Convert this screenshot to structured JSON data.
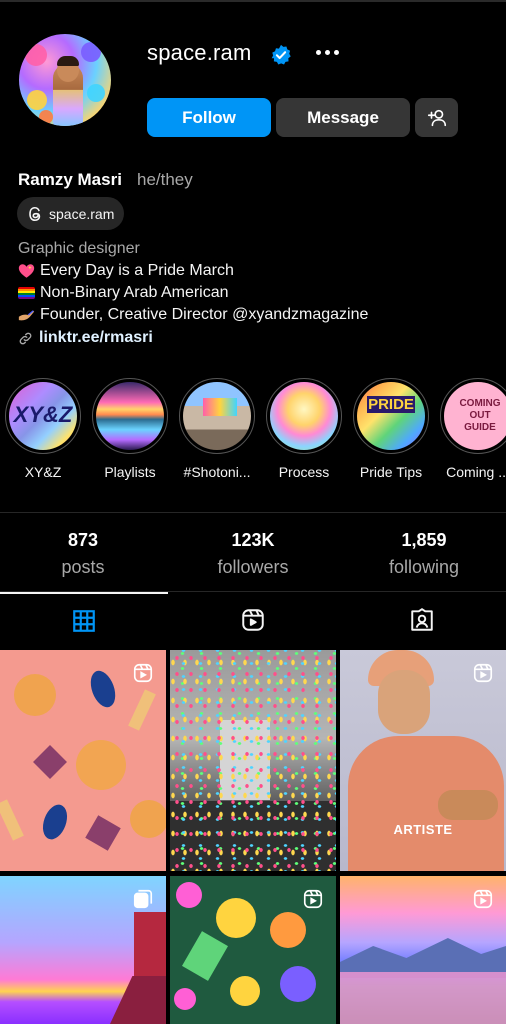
{
  "profile": {
    "username": "space.ram",
    "full_name": "Ramzy Masri",
    "pronouns": "he/they",
    "threads_handle": "space.ram",
    "category": "Graphic designer",
    "bio_lines": [
      "Every Day is a Pride March",
      "Non-Binary Arab American",
      "Founder, Creative Director @xyandzmagazine"
    ],
    "link": "linktr.ee/rmasri"
  },
  "actions": {
    "follow": "Follow",
    "message": "Message"
  },
  "highlights": [
    {
      "label": "XY&Z",
      "text": "XY&Z"
    },
    {
      "label": "Playlists"
    },
    {
      "label": "#Shotoni..."
    },
    {
      "label": "Process"
    },
    {
      "label": "Pride Tips",
      "text": "PRIDE"
    },
    {
      "label": "Coming ...",
      "text": "COMING OUT GUIDE"
    }
  ],
  "stats": [
    {
      "value": "873",
      "label": "posts"
    },
    {
      "value": "123K",
      "label": "followers"
    },
    {
      "value": "1,859",
      "label": "following"
    }
  ],
  "tabs": [
    "posts-grid",
    "reels",
    "tagged"
  ],
  "posts": [
    {
      "type": "reel"
    },
    {
      "type": "photo"
    },
    {
      "type": "reel",
      "caption": "ARTISTE"
    },
    {
      "type": "carousel"
    },
    {
      "type": "reel"
    },
    {
      "type": "reel"
    }
  ],
  "colors": {
    "accent": "#0095f6",
    "background": "#000000",
    "secondary_button": "#363636",
    "muted_text": "#a8a8a8"
  }
}
